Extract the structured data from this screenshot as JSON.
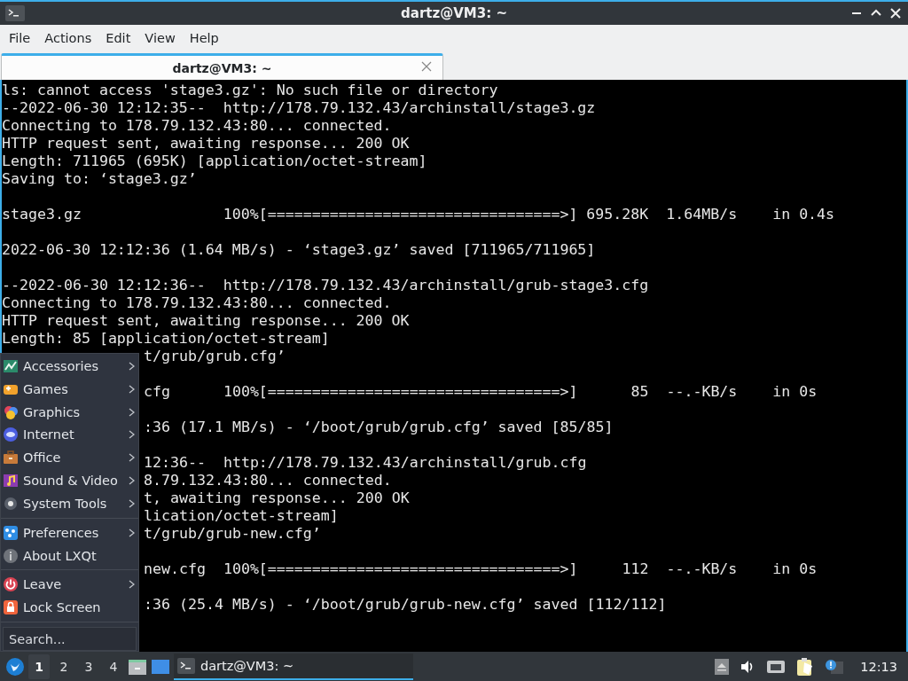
{
  "window": {
    "title": "dartz@VM3: ~"
  },
  "menubar": [
    "File",
    "Actions",
    "Edit",
    "View",
    "Help"
  ],
  "tabs": [
    {
      "label": "dartz@VM3: ~",
      "selected": true
    }
  ],
  "terminal": {
    "lines": [
      {
        "kind": "line",
        "text": "ls: cannot access 'stage3.gz': No such file or directory"
      },
      {
        "kind": "line",
        "text": "--2022-06-30 12:12:35--  http://178.79.132.43/archinstall/stage3.gz"
      },
      {
        "kind": "line",
        "text": "Connecting to 178.79.132.43:80... connected."
      },
      {
        "kind": "line",
        "text": "HTTP request sent, awaiting response... 200 OK"
      },
      {
        "kind": "line",
        "text": "Length: 711965 (695K) [application/octet-stream]"
      },
      {
        "kind": "line",
        "text": "Saving to: ‘stage3.gz’"
      },
      {
        "kind": "blank"
      },
      {
        "kind": "line",
        "text": "stage3.gz                100%[=================================>] 695.28K  1.64MB/s    in 0.4s"
      },
      {
        "kind": "blank"
      },
      {
        "kind": "line",
        "text": "2022-06-30 12:12:36 (1.64 MB/s) - ‘stage3.gz’ saved [711965/711965]"
      },
      {
        "kind": "blank"
      },
      {
        "kind": "line",
        "text": "--2022-06-30 12:12:36--  http://178.79.132.43/archinstall/grub-stage3.cfg"
      },
      {
        "kind": "line",
        "text": "Connecting to 178.79.132.43:80... connected."
      },
      {
        "kind": "line",
        "text": "HTTP request sent, awaiting response... 200 OK"
      },
      {
        "kind": "line",
        "text": "Length: 85 [application/octet-stream]"
      },
      {
        "kind": "covered",
        "text": "t/grub/grub.cfg’"
      },
      {
        "kind": "blank"
      },
      {
        "kind": "covered",
        "text": "cfg      100%[=================================>]      85  --.-KB/s    in 0s"
      },
      {
        "kind": "blank"
      },
      {
        "kind": "covered",
        "text": ":36 (17.1 MB/s) - ‘/boot/grub/grub.cfg’ saved [85/85]"
      },
      {
        "kind": "blank"
      },
      {
        "kind": "covered",
        "text": "12:36--  http://178.79.132.43/archinstall/grub.cfg"
      },
      {
        "kind": "covered",
        "text": "8.79.132.43:80... connected."
      },
      {
        "kind": "covered",
        "text": "t, awaiting response... 200 OK"
      },
      {
        "kind": "covered",
        "text": "lication/octet-stream]"
      },
      {
        "kind": "covered",
        "text": "t/grub/grub-new.cfg’"
      },
      {
        "kind": "blank"
      },
      {
        "kind": "covered",
        "text": "new.cfg  100%[=================================>]     112  --.-KB/s    in 0s"
      },
      {
        "kind": "blank"
      },
      {
        "kind": "covered",
        "text": ":36 (25.4 MB/s) - ‘/boot/grub/grub-new.cfg’ saved [112/112]"
      }
    ]
  },
  "start_menu": {
    "groups": [
      [
        {
          "kind": "accessories",
          "label": "Accessories",
          "submenu": true
        },
        {
          "kind": "games",
          "label": "Games",
          "submenu": true
        },
        {
          "kind": "graphics",
          "label": "Graphics",
          "submenu": true
        },
        {
          "kind": "internet",
          "label": "Internet",
          "submenu": true
        },
        {
          "kind": "office",
          "label": "Office",
          "submenu": true
        },
        {
          "kind": "media",
          "label": "Sound & Video",
          "submenu": true
        },
        {
          "kind": "tools",
          "label": "System Tools",
          "submenu": true
        }
      ],
      [
        {
          "kind": "preferences",
          "label": "Preferences",
          "submenu": true
        },
        {
          "kind": "about",
          "label": "About LXQt",
          "submenu": false
        }
      ],
      [
        {
          "kind": "leave",
          "label": "Leave",
          "submenu": true
        },
        {
          "kind": "lock",
          "label": "Lock Screen",
          "submenu": false
        }
      ]
    ],
    "search": {
      "placeholder": "Search..."
    }
  },
  "taskbar": {
    "desktops": [
      {
        "label": "1",
        "selected": true
      },
      {
        "label": "2",
        "selected": false
      },
      {
        "label": "3",
        "selected": false
      },
      {
        "label": "4",
        "selected": false
      }
    ],
    "tasks": [
      {
        "label": "dartz@VM3: ~",
        "selected": true
      }
    ],
    "clock": "12:13"
  }
}
